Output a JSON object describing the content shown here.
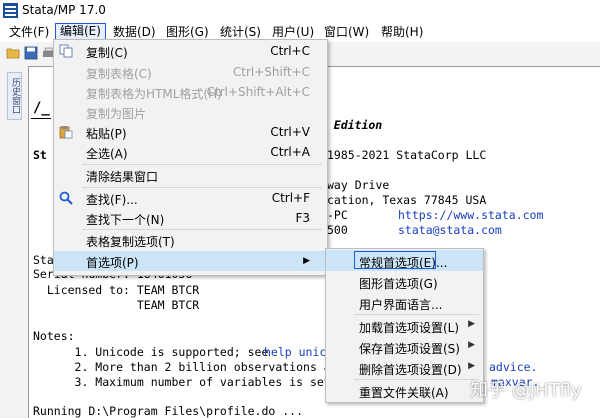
{
  "window": {
    "title": "Stata/MP 17.0"
  },
  "menubar": {
    "items": [
      {
        "label": "文件(F)"
      },
      {
        "label": "编辑(E)"
      },
      {
        "label": "数据(D)"
      },
      {
        "label": "图形(G)"
      },
      {
        "label": "统计(S)"
      },
      {
        "label": "用户(U)"
      },
      {
        "label": "窗口(W)"
      },
      {
        "label": "帮助(H)"
      }
    ]
  },
  "sidebar": {
    "history_tab": "历史窗口"
  },
  "edit_menu": {
    "items": [
      {
        "label": "复制(C)",
        "shortcut": "Ctrl+C"
      },
      {
        "label": "复制表格(C)",
        "shortcut": "Ctrl+Shift+C"
      },
      {
        "label": "复制表格为HTML格式(H)",
        "shortcut": "Ctrl+Shift+Alt+C"
      },
      {
        "label": "复制为图片",
        "shortcut": ""
      },
      {
        "label": "粘贴(P)",
        "shortcut": "Ctrl+V"
      },
      {
        "label": "全选(A)",
        "shortcut": "Ctrl+A"
      },
      {
        "label": "清除结果窗口",
        "shortcut": ""
      },
      {
        "label": "查找(F)...",
        "shortcut": "Ctrl+F"
      },
      {
        "label": "查找下一个(N)",
        "shortcut": "F3"
      },
      {
        "label": "表格复制选项(T)",
        "shortcut": ""
      },
      {
        "label": "首选项(P)",
        "shortcut": ""
      }
    ]
  },
  "prefs_submenu": {
    "items": [
      {
        "label": "常规首选项(E)..."
      },
      {
        "label": "图形首选项(G)"
      },
      {
        "label": "用户界面语言..."
      },
      {
        "label": "加载首选项设置(L)"
      },
      {
        "label": "保存首选项设置(S)"
      },
      {
        "label": "删除首选项设置(D)"
      },
      {
        "label": "重置文件关联(A)"
      }
    ]
  },
  "results": {
    "l1": "/_",
    "edition": "el Edition",
    "l3a": "St",
    "copyright": "1985-2021 StataCorp LLC",
    "addr1": "way Drive",
    "addr2": "cation, Texas 77845 USA",
    "l6a": "-PC",
    "url": "https://www.stata.com",
    "l7a": "500",
    "email": "stata@stata.com",
    "l8a": "Stat",
    "serial": "Serial number: 18461036",
    "licensed": "  Licensed to: TEAM BTCR",
    "licensed2": "               TEAM BTCR",
    "notes": "Notes:",
    "note1a": "      1. Unicode is supported; see ",
    "note1link": "help unico",
    "note2": "      2. More than 2 billion observations are",
    "note2tail": "advice.",
    "note3": "      3. Maximum number of variables is set t",
    "note3tail": "maxvar.",
    "running": "Running D:\\Program Files\\profile.do ..."
  },
  "watermark": "知乎 @JHTfly",
  "colors": {
    "accent_border": "#1f5bd3",
    "highlight": "#cce4f7",
    "link": "#1a3fc0"
  }
}
